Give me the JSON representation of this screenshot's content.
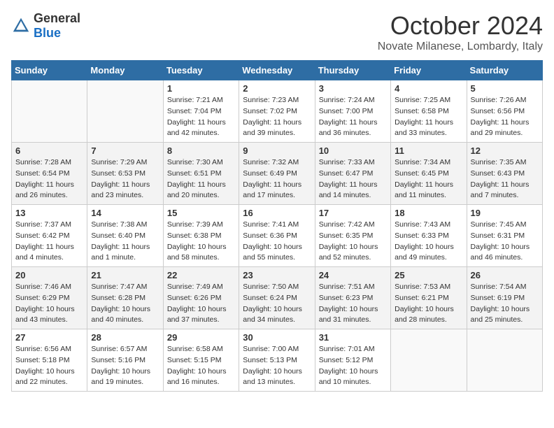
{
  "header": {
    "logo_general": "General",
    "logo_blue": "Blue",
    "month_title": "October 2024",
    "location": "Novate Milanese, Lombardy, Italy"
  },
  "days_of_week": [
    "Sunday",
    "Monday",
    "Tuesday",
    "Wednesday",
    "Thursday",
    "Friday",
    "Saturday"
  ],
  "weeks": [
    [
      {
        "day": "",
        "empty": true
      },
      {
        "day": "",
        "empty": true
      },
      {
        "day": "1",
        "sunrise": "Sunrise: 7:21 AM",
        "sunset": "Sunset: 7:04 PM",
        "daylight": "Daylight: 11 hours and 42 minutes."
      },
      {
        "day": "2",
        "sunrise": "Sunrise: 7:23 AM",
        "sunset": "Sunset: 7:02 PM",
        "daylight": "Daylight: 11 hours and 39 minutes."
      },
      {
        "day": "3",
        "sunrise": "Sunrise: 7:24 AM",
        "sunset": "Sunset: 7:00 PM",
        "daylight": "Daylight: 11 hours and 36 minutes."
      },
      {
        "day": "4",
        "sunrise": "Sunrise: 7:25 AM",
        "sunset": "Sunset: 6:58 PM",
        "daylight": "Daylight: 11 hours and 33 minutes."
      },
      {
        "day": "5",
        "sunrise": "Sunrise: 7:26 AM",
        "sunset": "Sunset: 6:56 PM",
        "daylight": "Daylight: 11 hours and 29 minutes."
      }
    ],
    [
      {
        "day": "6",
        "sunrise": "Sunrise: 7:28 AM",
        "sunset": "Sunset: 6:54 PM",
        "daylight": "Daylight: 11 hours and 26 minutes."
      },
      {
        "day": "7",
        "sunrise": "Sunrise: 7:29 AM",
        "sunset": "Sunset: 6:53 PM",
        "daylight": "Daylight: 11 hours and 23 minutes."
      },
      {
        "day": "8",
        "sunrise": "Sunrise: 7:30 AM",
        "sunset": "Sunset: 6:51 PM",
        "daylight": "Daylight: 11 hours and 20 minutes."
      },
      {
        "day": "9",
        "sunrise": "Sunrise: 7:32 AM",
        "sunset": "Sunset: 6:49 PM",
        "daylight": "Daylight: 11 hours and 17 minutes."
      },
      {
        "day": "10",
        "sunrise": "Sunrise: 7:33 AM",
        "sunset": "Sunset: 6:47 PM",
        "daylight": "Daylight: 11 hours and 14 minutes."
      },
      {
        "day": "11",
        "sunrise": "Sunrise: 7:34 AM",
        "sunset": "Sunset: 6:45 PM",
        "daylight": "Daylight: 11 hours and 11 minutes."
      },
      {
        "day": "12",
        "sunrise": "Sunrise: 7:35 AM",
        "sunset": "Sunset: 6:43 PM",
        "daylight": "Daylight: 11 hours and 7 minutes."
      }
    ],
    [
      {
        "day": "13",
        "sunrise": "Sunrise: 7:37 AM",
        "sunset": "Sunset: 6:42 PM",
        "daylight": "Daylight: 11 hours and 4 minutes."
      },
      {
        "day": "14",
        "sunrise": "Sunrise: 7:38 AM",
        "sunset": "Sunset: 6:40 PM",
        "daylight": "Daylight: 11 hours and 1 minute."
      },
      {
        "day": "15",
        "sunrise": "Sunrise: 7:39 AM",
        "sunset": "Sunset: 6:38 PM",
        "daylight": "Daylight: 10 hours and 58 minutes."
      },
      {
        "day": "16",
        "sunrise": "Sunrise: 7:41 AM",
        "sunset": "Sunset: 6:36 PM",
        "daylight": "Daylight: 10 hours and 55 minutes."
      },
      {
        "day": "17",
        "sunrise": "Sunrise: 7:42 AM",
        "sunset": "Sunset: 6:35 PM",
        "daylight": "Daylight: 10 hours and 52 minutes."
      },
      {
        "day": "18",
        "sunrise": "Sunrise: 7:43 AM",
        "sunset": "Sunset: 6:33 PM",
        "daylight": "Daylight: 10 hours and 49 minutes."
      },
      {
        "day": "19",
        "sunrise": "Sunrise: 7:45 AM",
        "sunset": "Sunset: 6:31 PM",
        "daylight": "Daylight: 10 hours and 46 minutes."
      }
    ],
    [
      {
        "day": "20",
        "sunrise": "Sunrise: 7:46 AM",
        "sunset": "Sunset: 6:29 PM",
        "daylight": "Daylight: 10 hours and 43 minutes."
      },
      {
        "day": "21",
        "sunrise": "Sunrise: 7:47 AM",
        "sunset": "Sunset: 6:28 PM",
        "daylight": "Daylight: 10 hours and 40 minutes."
      },
      {
        "day": "22",
        "sunrise": "Sunrise: 7:49 AM",
        "sunset": "Sunset: 6:26 PM",
        "daylight": "Daylight: 10 hours and 37 minutes."
      },
      {
        "day": "23",
        "sunrise": "Sunrise: 7:50 AM",
        "sunset": "Sunset: 6:24 PM",
        "daylight": "Daylight: 10 hours and 34 minutes."
      },
      {
        "day": "24",
        "sunrise": "Sunrise: 7:51 AM",
        "sunset": "Sunset: 6:23 PM",
        "daylight": "Daylight: 10 hours and 31 minutes."
      },
      {
        "day": "25",
        "sunrise": "Sunrise: 7:53 AM",
        "sunset": "Sunset: 6:21 PM",
        "daylight": "Daylight: 10 hours and 28 minutes."
      },
      {
        "day": "26",
        "sunrise": "Sunrise: 7:54 AM",
        "sunset": "Sunset: 6:19 PM",
        "daylight": "Daylight: 10 hours and 25 minutes."
      }
    ],
    [
      {
        "day": "27",
        "sunrise": "Sunrise: 6:56 AM",
        "sunset": "Sunset: 5:18 PM",
        "daylight": "Daylight: 10 hours and 22 minutes."
      },
      {
        "day": "28",
        "sunrise": "Sunrise: 6:57 AM",
        "sunset": "Sunset: 5:16 PM",
        "daylight": "Daylight: 10 hours and 19 minutes."
      },
      {
        "day": "29",
        "sunrise": "Sunrise: 6:58 AM",
        "sunset": "Sunset: 5:15 PM",
        "daylight": "Daylight: 10 hours and 16 minutes."
      },
      {
        "day": "30",
        "sunrise": "Sunrise: 7:00 AM",
        "sunset": "Sunset: 5:13 PM",
        "daylight": "Daylight: 10 hours and 13 minutes."
      },
      {
        "day": "31",
        "sunrise": "Sunrise: 7:01 AM",
        "sunset": "Sunset: 5:12 PM",
        "daylight": "Daylight: 10 hours and 10 minutes."
      },
      {
        "day": "",
        "empty": true
      },
      {
        "day": "",
        "empty": true
      }
    ]
  ]
}
